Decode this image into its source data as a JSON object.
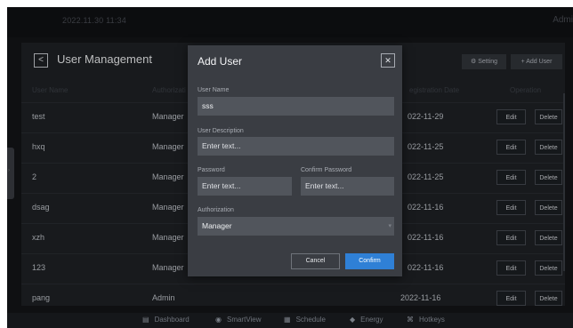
{
  "topbar": {
    "datetime": "2022.11.30  11:34",
    "user": "Admi"
  },
  "panel": {
    "title": "User Management",
    "back_icon": "chevron-left-icon",
    "setting_label": "Setting",
    "add_user_label": "+ Add User",
    "columns": {
      "user_name": "User Name",
      "authorization": "Authorizati",
      "registration_date": "egistration Date",
      "operation": "Operation"
    },
    "rows": [
      {
        "name": "test",
        "auth": "Manager",
        "date": "022-11-29"
      },
      {
        "name": "hxq",
        "auth": "Manager",
        "date": "022-11-25"
      },
      {
        "name": "2",
        "auth": "Manager",
        "date": "022-11-25"
      },
      {
        "name": "dsag",
        "auth": "Manager",
        "date": "022-11-16"
      },
      {
        "name": "xzh",
        "auth": "Manager",
        "date": "022-11-16"
      },
      {
        "name": "123",
        "auth": "Manager",
        "date": "022-11-16"
      },
      {
        "name": "pang",
        "auth": "Admin",
        "date": "2022-11-16"
      }
    ],
    "edit_label": "Edit",
    "delete_label": "Delete"
  },
  "modal": {
    "title": "Add User",
    "close_icon": "close-icon",
    "user_name_label": "User Name",
    "user_name_value": "sss",
    "user_desc_label": "User Description",
    "user_desc_placeholder": "Enter text...",
    "password_label": "Password",
    "password_placeholder": "Enter text...",
    "confirm_password_label": "Confirm Password",
    "confirm_password_placeholder": "Enter text...",
    "authorization_label": "Authorization",
    "authorization_value": "Manager",
    "cancel_label": "Cancel",
    "confirm_label": "Confirm"
  },
  "nav": {
    "items": [
      {
        "label": "Dashboard",
        "icon": "dashboard-icon"
      },
      {
        "label": "SmartView",
        "icon": "smartview-icon"
      },
      {
        "label": "Schedule",
        "icon": "schedule-icon"
      },
      {
        "label": "Energy",
        "icon": "energy-icon"
      },
      {
        "label": "Hotkeys",
        "icon": "hotkeys-icon"
      }
    ]
  },
  "colors": {
    "background": "#141518",
    "panel": "#1f2226",
    "modal": "#3a3d43",
    "field": "#51555c",
    "accent": "#2f80d6"
  }
}
